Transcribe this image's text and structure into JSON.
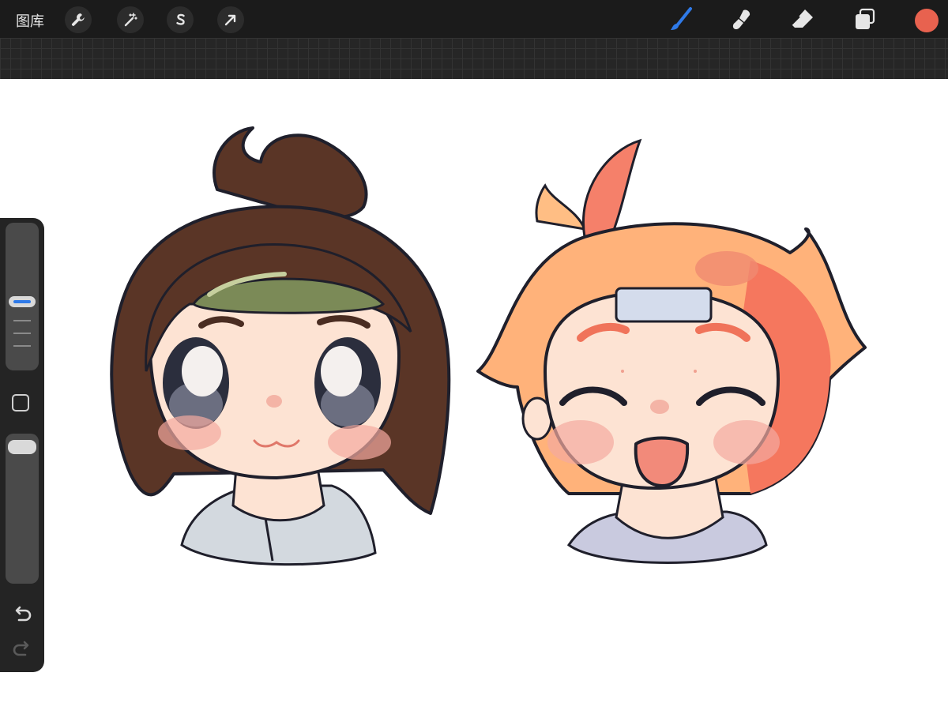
{
  "app": {
    "gallery_label": "图库"
  },
  "toolbar": {
    "left_icons": [
      "wrench-icon",
      "magic-wand-icon",
      "selection-s-icon",
      "move-arrow-icon"
    ],
    "right_icons": [
      "brush-icon",
      "smudge-icon",
      "eraser-icon",
      "layers-icon"
    ],
    "active_tool": "brush",
    "active_tool_color": "#2f7ae8",
    "current_color": "#e8624f"
  },
  "sidebar": {
    "icons": [
      "brush-size-slider",
      "modify-button",
      "opacity-slider",
      "undo-icon",
      "redo-icon"
    ],
    "accent_color": "#2f7ae8"
  },
  "canvas": {
    "background": "#ffffff",
    "artwork": [
      "brown-haired-girl-with-bun-and-headband",
      "orange-haired-kid-smiling-with-bandage"
    ]
  }
}
